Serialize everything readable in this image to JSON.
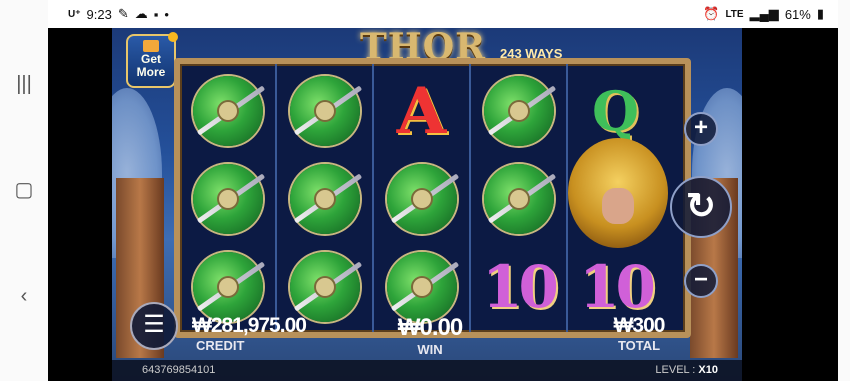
{
  "status_bar": {
    "carrier": "U⁺",
    "time": "9:23",
    "lte": "LTE",
    "battery": "61%"
  },
  "game": {
    "title": "THOR",
    "ways": "243 WAYS",
    "get_more": {
      "line1": "Get",
      "line2": "More"
    },
    "reels": [
      [
        "shield",
        "shield",
        "shield"
      ],
      [
        "shield",
        "shield",
        "shield"
      ],
      [
        "A",
        "shield",
        "shield"
      ],
      [
        "shield",
        "shield",
        "10"
      ],
      [
        "Q",
        "thor",
        "10"
      ]
    ],
    "credit": {
      "value": "₩281,975.00",
      "label": "CREDIT"
    },
    "win": {
      "value": "₩0.00",
      "label": "WIN"
    },
    "total": {
      "value": "₩300",
      "label": "TOTAL"
    },
    "serial": "643769854101",
    "level": {
      "label": "LEVEL :",
      "value": "X10"
    },
    "buttons": {
      "plus": "+",
      "minus": "−",
      "spin": "↻",
      "menu": "☰"
    }
  },
  "colors": {
    "accent": "#b8915a",
    "background": "#24509a"
  }
}
